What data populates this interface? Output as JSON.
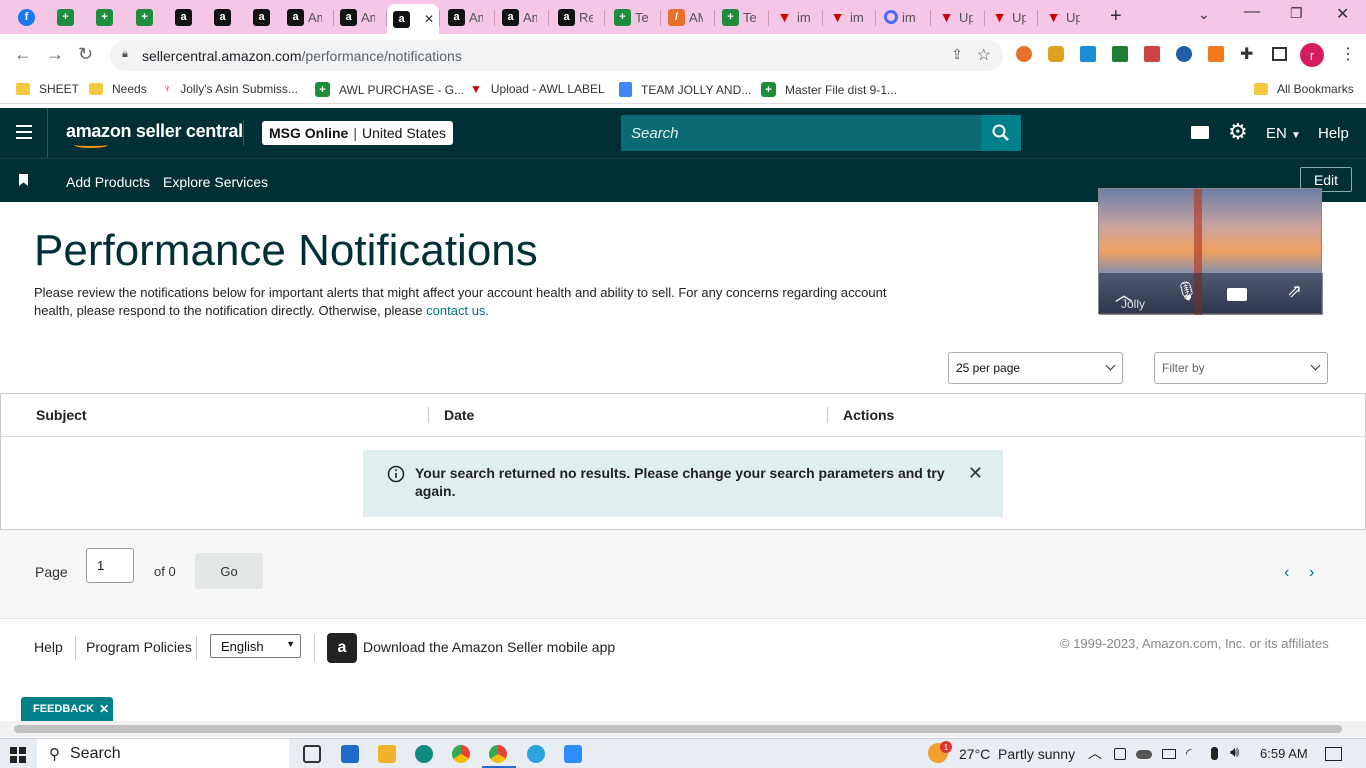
{
  "browser": {
    "tabs": [
      {
        "icon": "facebook-icon",
        "kind": "fb",
        "glyph": "f",
        "label": ""
      },
      {
        "icon": "sheets-icon",
        "kind": "sheet",
        "glyph": "+",
        "label": ""
      },
      {
        "icon": "sheets-icon",
        "kind": "sheet",
        "glyph": "+",
        "label": ""
      },
      {
        "icon": "sheets-icon",
        "kind": "sheet",
        "glyph": "+",
        "label": ""
      },
      {
        "icon": "amazon-icon",
        "kind": "amz",
        "glyph": "a",
        "label": ""
      },
      {
        "icon": "amazon-icon",
        "kind": "amz",
        "glyph": "a",
        "label": ""
      },
      {
        "icon": "amazon-icon",
        "kind": "amz",
        "glyph": "a",
        "label": ""
      },
      {
        "icon": "amazon-icon",
        "kind": "amz",
        "glyph": "a",
        "label": "Am"
      },
      {
        "icon": "amazon-icon",
        "kind": "amz",
        "glyph": "a",
        "label": "Am"
      },
      {
        "icon": "amazon-icon",
        "kind": "amz",
        "glyph": "a",
        "label": "",
        "active": true
      },
      {
        "icon": "amazon-icon",
        "kind": "amz",
        "glyph": "a",
        "label": "Am"
      },
      {
        "icon": "amazon-icon",
        "kind": "amz",
        "glyph": "a",
        "label": "Am"
      },
      {
        "icon": "amazon-icon",
        "kind": "amz",
        "glyph": "a",
        "label": "Re"
      },
      {
        "icon": "sheets-icon",
        "kind": "sheet",
        "glyph": "+",
        "label": "Te"
      },
      {
        "icon": "app-icon",
        "kind": "oth",
        "glyph": "/",
        "label": "AM"
      },
      {
        "icon": "sheets-icon",
        "kind": "sheet",
        "glyph": "+",
        "label": "Te"
      },
      {
        "icon": "v-icon",
        "kind": "tri",
        "glyph": "▼",
        "label": "im"
      },
      {
        "icon": "v-icon",
        "kind": "tri",
        "glyph": "▼",
        "label": "im"
      },
      {
        "icon": "ring-icon",
        "kind": "ring",
        "glyph": "",
        "label": "im"
      },
      {
        "icon": "v-icon",
        "kind": "tri",
        "glyph": "▼",
        "label": "Up"
      },
      {
        "icon": "v-icon",
        "kind": "tri",
        "glyph": "▼",
        "label": "Up"
      },
      {
        "icon": "v-icon",
        "kind": "tri",
        "glyph": "▼",
        "label": "Up"
      }
    ],
    "url_host": "sellercentral.amazon.com",
    "url_path": "/performance/notifications",
    "profile_initial": "r",
    "bookmarks": [
      {
        "label": "SHEET",
        "icon": "folder"
      },
      {
        "label": "Needs",
        "icon": "folder"
      },
      {
        "label": "Jolly's Asin Submiss...",
        "icon": "site"
      },
      {
        "label": "AWL PURCHASE - G...",
        "icon": "sheet"
      },
      {
        "label": "Upload - AWL LABEL",
        "icon": "v"
      },
      {
        "label": "TEAM JOLLY AND...",
        "icon": "doc"
      },
      {
        "label": "Master File dist 9-1...",
        "icon": "sheet"
      }
    ],
    "all_bookmarks": "All Bookmarks"
  },
  "header": {
    "logo_text": "amazon seller central",
    "store_name": "MSG Online",
    "store_region": "United States",
    "search_placeholder": "Search",
    "language": "EN",
    "help": "Help"
  },
  "subnav": {
    "items": [
      "Add Products",
      "Explore Services"
    ],
    "edit": "Edit"
  },
  "video": {
    "name": "Jolly"
  },
  "main": {
    "title": "Performance Notifications",
    "desc": "Please review the notifications below for important alerts that might affect your account health and ability to sell. For any concerns regarding account health, please respond to the notification directly. Otherwise, please",
    "contact_link": "contact us.",
    "per_page": "25 per page",
    "filter": "Filter by",
    "columns": [
      "Subject",
      "Date",
      "Actions"
    ],
    "alert": "Your search returned no results. Please change your search parameters and try again.",
    "page_label": "Page",
    "page_value": "1",
    "page_total": "of 0",
    "go": "Go"
  },
  "footer": {
    "help": "Help",
    "policies": "Program Policies",
    "language": "English",
    "app": "Download the Amazon Seller mobile app",
    "copyright": "© 1999-2023, Amazon.com, Inc. or its affiliates",
    "feedback": "FEEDBACK"
  },
  "taskbar": {
    "search": "Search",
    "weather": "27°C  Partly sunny",
    "time": "6:59 AM",
    "badge": "1"
  }
}
